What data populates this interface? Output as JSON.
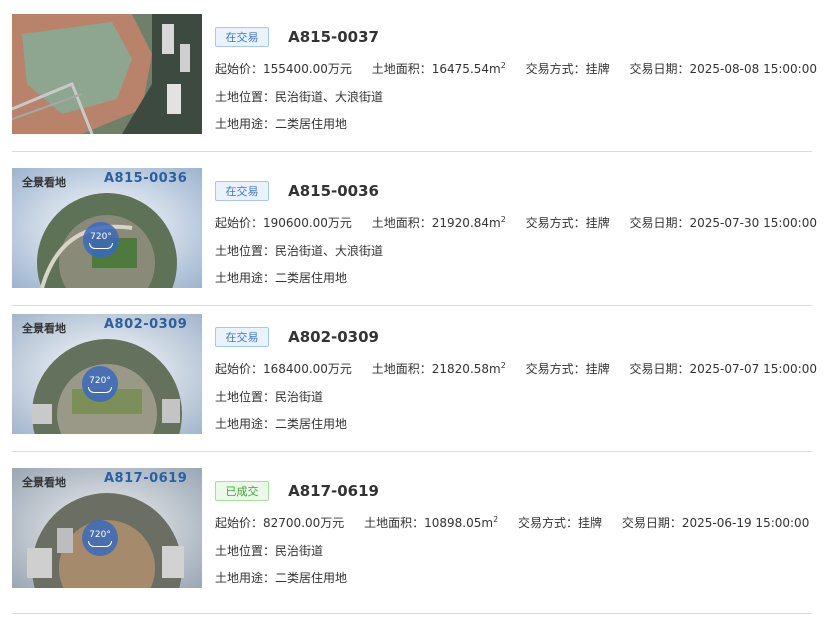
{
  "labels": {
    "start_price": "起始价：",
    "land_area": "土地面积：",
    "trade_method": "交易方式：",
    "trade_date": "交易日期：",
    "location": "土地位置：",
    "usage": "土地用途："
  },
  "listings": [
    {
      "status": "在交易",
      "status_type": "trading",
      "code": "A815-0037",
      "start_price": "155400.00万元",
      "area_value": "16475.54m",
      "area_unit_exp": "2",
      "trade_method": "挂牌",
      "trade_date": "2025-08-08 15:00:00",
      "location": "民治街道、大浪街道",
      "usage": "二类居住用地",
      "thumb": {
        "type": "aerial",
        "pano_logo": "",
        "pano_code": "",
        "badge": ""
      }
    },
    {
      "status": "在交易",
      "status_type": "trading",
      "code": "A815-0036",
      "start_price": "190600.00万元",
      "area_value": "21920.84m",
      "area_unit_exp": "2",
      "trade_method": "挂牌",
      "trade_date": "2025-07-30 15:00:00",
      "location": "民治街道、大浪街道",
      "usage": "二类居住用地",
      "thumb": {
        "type": "pano",
        "pano_logo": "全景看地",
        "pano_code": "A815-0036",
        "badge": "720°"
      }
    },
    {
      "status": "在交易",
      "status_type": "trading",
      "code": "A802-0309",
      "start_price": "168400.00万元",
      "area_value": "21820.58m",
      "area_unit_exp": "2",
      "trade_method": "挂牌",
      "trade_date": "2025-07-07 15:00:00",
      "location": "民治街道",
      "usage": "二类居住用地",
      "thumb": {
        "type": "pano",
        "pano_logo": "全景看地",
        "pano_code": "A802-0309",
        "badge": "720°"
      }
    },
    {
      "status": "已成交",
      "status_type": "done",
      "code": "A817-0619",
      "start_price": "82700.00万元",
      "area_value": "10898.05m",
      "area_unit_exp": "2",
      "trade_method": "挂牌",
      "trade_date": "2025-06-19 15:00:00",
      "location": "民治街道",
      "usage": "二类居住用地",
      "thumb": {
        "type": "pano",
        "pano_logo": "全景看地",
        "pano_code": "A817-0619",
        "badge": "720°"
      }
    }
  ],
  "colors": {
    "trading_text": "#3f78c8",
    "done_text": "#44a33a",
    "pano_code": "#2b5f9e",
    "divider": "#dcdcdc"
  }
}
